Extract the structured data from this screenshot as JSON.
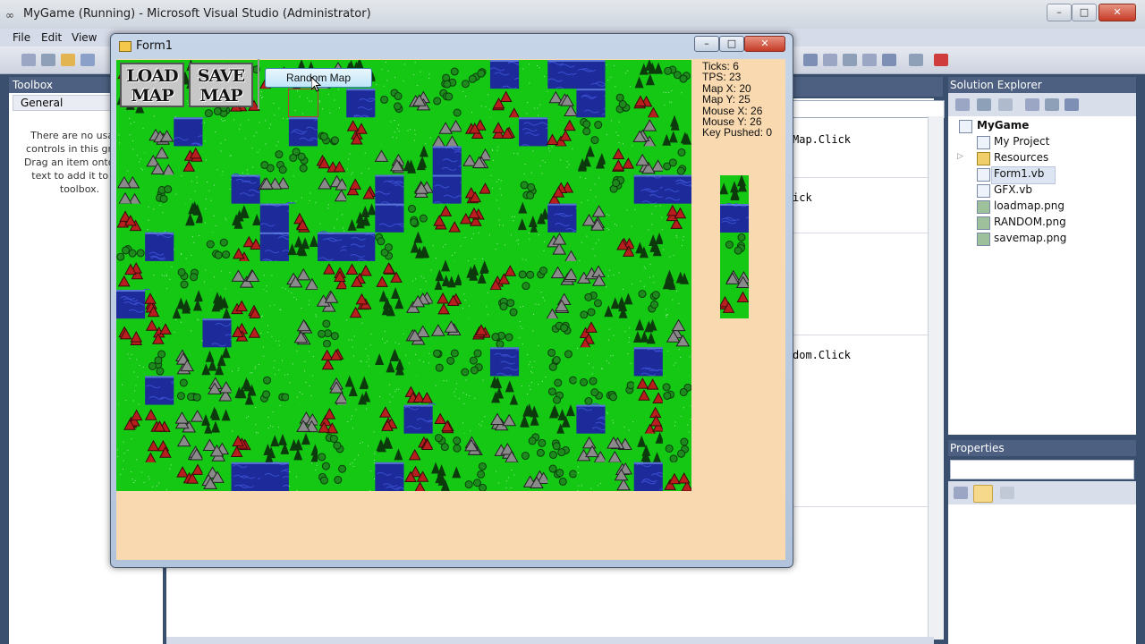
{
  "vs": {
    "title": "MyGame (Running) - Microsoft Visual Studio (Administrator)",
    "menu": [
      "File",
      "Edit",
      "View"
    ],
    "toolbox": {
      "title": "Toolbox",
      "group": "General",
      "empty_text": "There are no usable controls in this group. Drag an item onto this text to add it to the toolbox."
    },
    "code_lines": [
      "Map.Click",
      "ick",
      "dom.Click"
    ],
    "solution_explorer": {
      "title": "Solution Explorer",
      "items": [
        {
          "label": "MyGame",
          "icon": "project-icon"
        },
        {
          "label": "My Project",
          "icon": "settings-icon"
        },
        {
          "label": "Resources",
          "icon": "folder-icon"
        },
        {
          "label": "Form1.vb",
          "icon": "form-icon"
        },
        {
          "label": "GFX.vb",
          "icon": "vb-file-icon"
        },
        {
          "label": "loadmap.png",
          "icon": "image-file-icon"
        },
        {
          "label": "RANDOM.png",
          "icon": "image-file-icon"
        },
        {
          "label": "savemap.png",
          "icon": "image-file-icon"
        }
      ]
    },
    "properties": {
      "title": "Properties"
    }
  },
  "form": {
    "title": "Form1",
    "load_button": [
      "LOAD",
      "MAP"
    ],
    "save_button": [
      "SAVE",
      "MAP"
    ],
    "random_button": "Random Map",
    "stats": {
      "ticks": "Ticks: 6",
      "tps": "TPS: 23",
      "map_x": "Map X: 20",
      "map_y": "Map Y: 25",
      "mouse_x": "Mouse X: 26",
      "mouse_y": "Mouse Y: 26",
      "key": "Key Pushed: 0"
    },
    "palette": [
      "forest",
      "water",
      "trees",
      "mountains",
      "volcano"
    ]
  },
  "colors": {
    "grass": "#14c814",
    "water": "#1c2a9a",
    "forest": "#0d3a0d",
    "mountain": "#8a8a8a",
    "lava": "#b81e1e",
    "form_bg": "#f9d9b0"
  }
}
